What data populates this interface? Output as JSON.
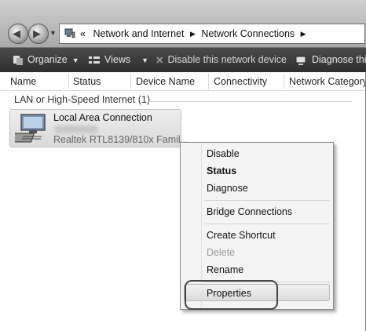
{
  "address": {
    "prefix": "«",
    "crumbs": [
      "Network and Internet",
      "Network Connections"
    ]
  },
  "toolbar": {
    "organize": "Organize",
    "views": "Views",
    "disable": "Disable this network device",
    "diagnose": "Diagnose this"
  },
  "columns": [
    "Name",
    "Status",
    "Device Name",
    "Connectivity",
    "Network Category"
  ],
  "group": {
    "label": "LAN or High-Speed Internet (1)"
  },
  "connection": {
    "name": "Local Area Connection",
    "device": "Realtek RTL8139/810x Famil..."
  },
  "menu": {
    "disable": "Disable",
    "status": "Status",
    "diagnose": "Diagnose",
    "bridge": "Bridge Connections",
    "shortcut": "Create Shortcut",
    "delete": "Delete",
    "rename": "Rename",
    "properties": "Properties"
  },
  "colors": {
    "toolbar_bg": "#3a3a3a",
    "menu_bg": "#f4f4f4",
    "disabled_text": "#9a9a9a"
  },
  "icons": [
    "back-arrow-icon",
    "forward-arrow-icon",
    "network-folder-icon",
    "organize-icon",
    "views-icon",
    "disable-x-icon",
    "diagnose-icon",
    "network-adapter-icon"
  ]
}
